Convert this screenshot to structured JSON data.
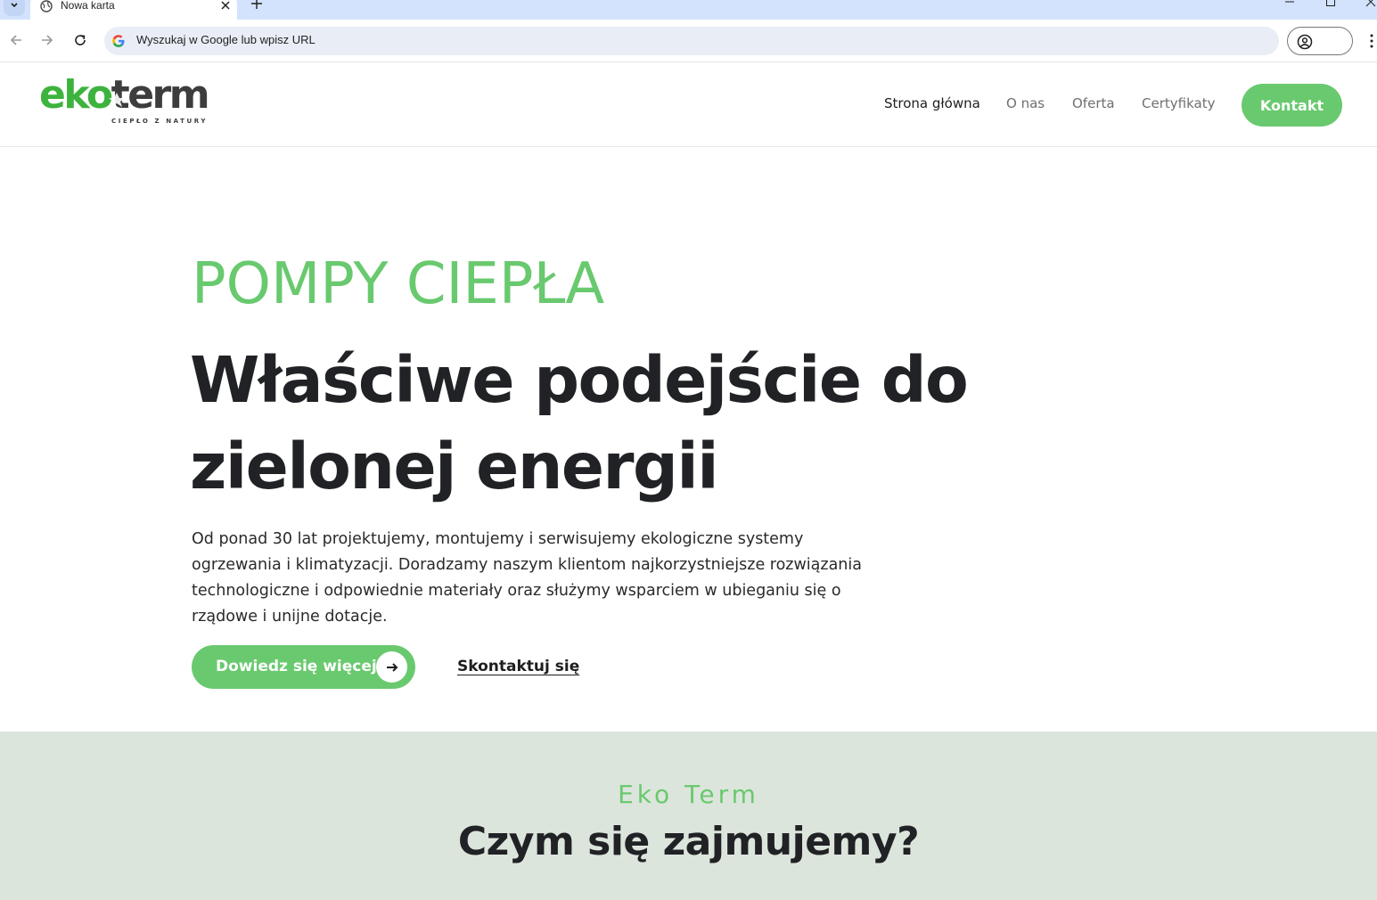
{
  "browser": {
    "tab_title": "Nowa karta",
    "omnibox_placeholder": "Wyszukaj w Google lub wpisz URL",
    "icons": [
      "tab-search-icon",
      "globe-icon",
      "close-icon",
      "plus-icon",
      "minimize-icon",
      "maximize-icon",
      "window-close-icon",
      "back-arrow-icon",
      "forward-arrow-icon",
      "reload-icon",
      "google-g-icon",
      "profile-icon",
      "kebab-menu-icon"
    ]
  },
  "header": {
    "logo": {
      "word_1": "eko",
      "word_2": "term",
      "tagline": "CIEPŁO Z NATURY"
    },
    "nav": [
      {
        "label": "Strona główna",
        "active": true
      },
      {
        "label": "O nas",
        "active": false
      },
      {
        "label": "Oferta",
        "active": false
      },
      {
        "label": "Certyfikaty",
        "active": false
      }
    ],
    "cta": "Kontakt"
  },
  "hero": {
    "eyebrow": "POMPY CIEPŁA",
    "title": "Właściwe podejście do zielonej energii",
    "description": "Od ponad 30 lat projektujemy, montujemy i serwisujemy ekologiczne systemy ogrzewania i klimatyzacji. Doradzamy naszym klientom najkorzystniejsze rozwiązania technologiczne i odpowiednie materiały oraz służymy wsparciem w ubieganiu się o rządowe i unijne dotacje.",
    "primary_button": "Dowiedz się więcej",
    "secondary_link": "Skontaktuj się"
  },
  "section": {
    "eyebrow": "Eko Term",
    "title": "Czym się zajmujemy?"
  },
  "colors": {
    "brand_green": "#69c96e",
    "logo_green": "#3db33e",
    "text_dark": "#212225",
    "section_bg": "#dce5dc",
    "tabstrip_bg": "#d3e3fd"
  }
}
